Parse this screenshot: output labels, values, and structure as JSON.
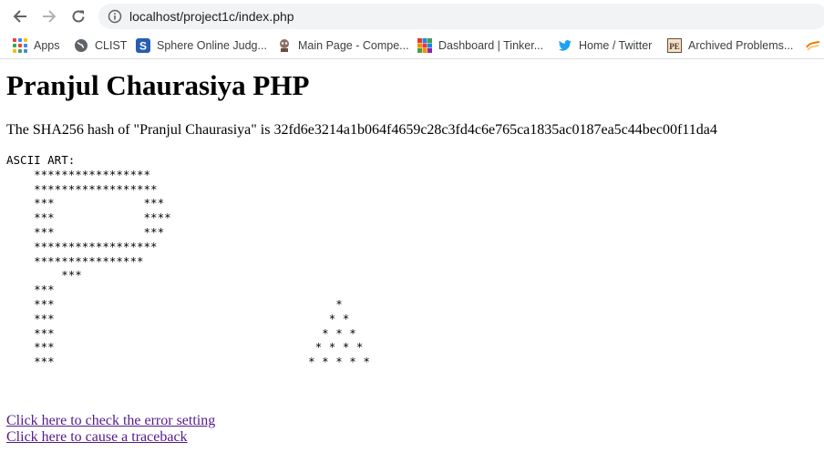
{
  "browser": {
    "url": "localhost/project1c/index.php",
    "bookmarks": [
      {
        "label": "Apps",
        "icon": "apps-grid-icon"
      },
      {
        "label": "CLIST",
        "icon": "clist-globe-icon"
      },
      {
        "label": "Sphere Online Judg...",
        "icon": "sphere-judge-icon"
      },
      {
        "label": "Main Page - Compe...",
        "icon": "wiki-icon"
      },
      {
        "label": "Dashboard | Tinker...",
        "icon": "tinkercad-icon"
      },
      {
        "label": "Home / Twitter",
        "icon": "twitter-bird-icon"
      },
      {
        "label": "Archived Problems...",
        "icon": "project-euler-icon"
      }
    ]
  },
  "page": {
    "heading": "Pranjul Chaurasiya PHP",
    "hash_text": "The SHA256 hash of \"Pranjul Chaurasiya\" is 32fd6e3214a1b064f4659c28c3fd4c6e765ca1835ac0187ea5c44bec00f11da4",
    "ascii_art": "ASCII ART:\n    *****************\n    ******************\n    ***             ***\n    ***             ****\n    ***             ***\n    ******************\n    ****************\n        ***\n    ***\n    ***                                         *\n    ***                                        * *\n    ***                                       * * *\n    ***                                      * * * *\n    ***                                     * * * * *",
    "links": [
      "Click here to check the error setting",
      "Click here to cause a traceback"
    ]
  }
}
